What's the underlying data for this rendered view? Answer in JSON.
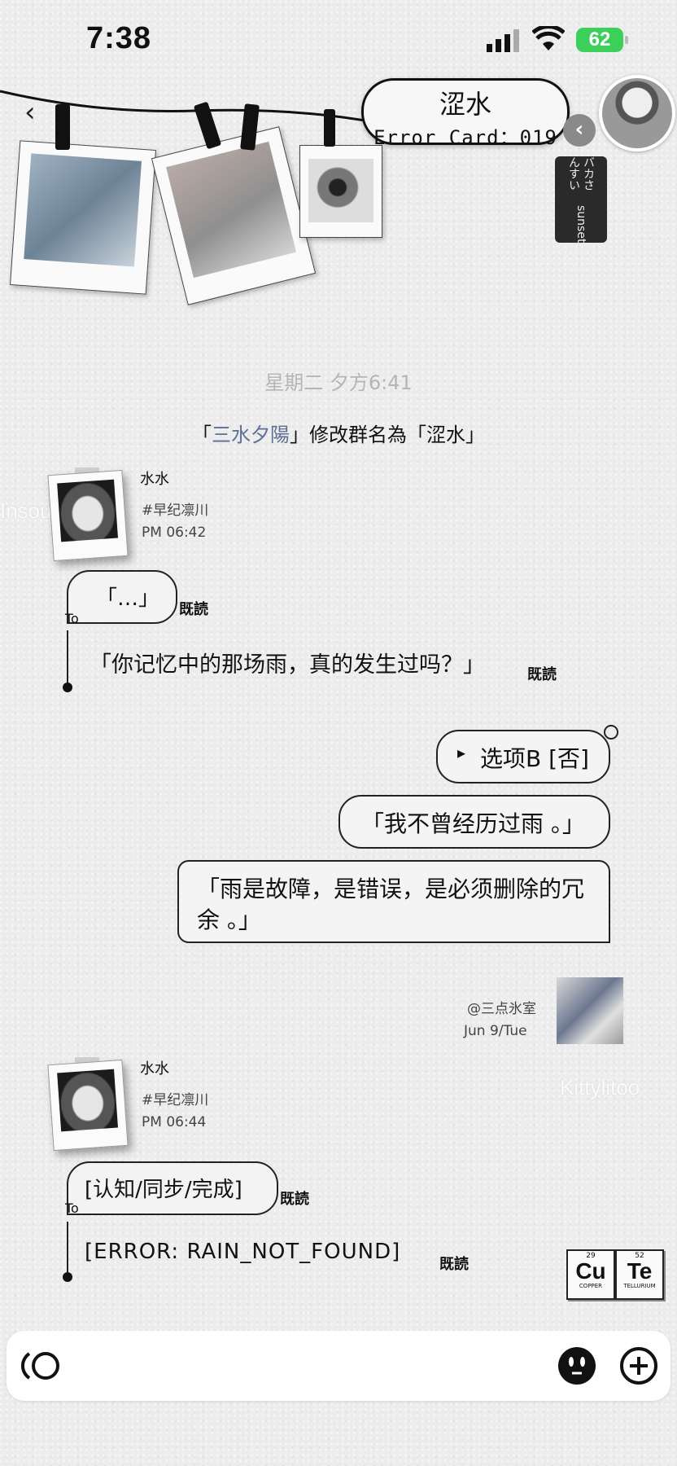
{
  "status_bar": {
    "time": "7:38",
    "battery": "62"
  },
  "header": {
    "group_name": "涩水",
    "card_label": "Error Card：019",
    "side_tab_line1": "バカさんすい",
    "side_tab_line2": "sunset"
  },
  "watermarks": [
    "Insoup",
    "Kittylitoo"
  ],
  "system": {
    "timestamp": "星期二 夕方6:41",
    "notice_prefix": "「",
    "notice_name": "三水夕陽",
    "notice_suffix": "」修改群名為「涩水」"
  },
  "messages_in": [
    {
      "sender": "水水",
      "tag": "#早纪凛川",
      "time": "PM 06:42",
      "bubble": "「…」",
      "quote": "「你记忆中的那场雨，真的发生过吗？」",
      "to_label": "To",
      "read1": "既読",
      "read2": "既読"
    },
    {
      "sender": "水水",
      "tag": "#早纪凛川",
      "time": "PM 06:44",
      "bubble": "[认知/同步/完成]",
      "quote": "[ERROR: RAIN_NOT_FOUND]",
      "to_label": "To",
      "read1": "既読",
      "read2": "既読"
    }
  ],
  "messages_out": [
    {
      "arrow": "▸",
      "text": "选项B [否]"
    },
    {
      "text": "「我不曾经历过雨 。」"
    },
    {
      "line1": "「雨是故障，是错误，是必须删除的冗",
      "line2": "余 。」"
    }
  ],
  "self": {
    "handle": "@三点氷室",
    "date": "Jun 9/Tue"
  },
  "stickers": [
    {
      "number": "29",
      "symbol": "Cu",
      "name": "COPPER"
    },
    {
      "number": "52",
      "symbol": "Te",
      "name": "TELLURIUM"
    }
  ]
}
